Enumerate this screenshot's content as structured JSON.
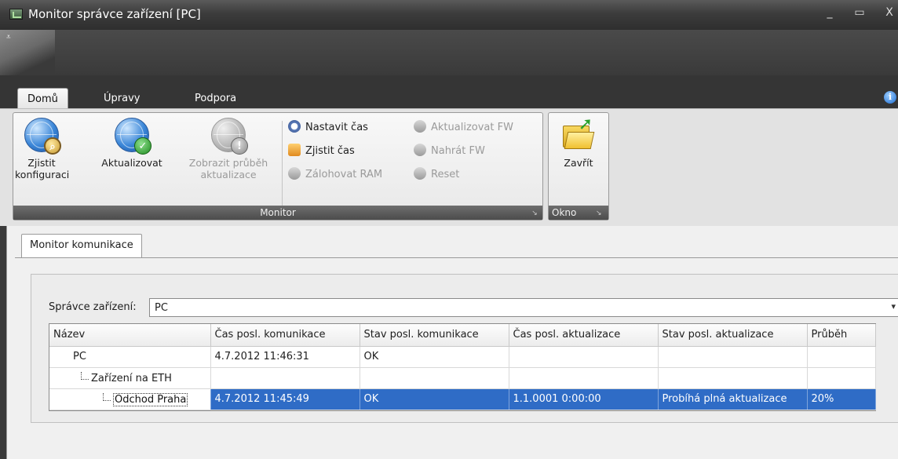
{
  "window": {
    "title": "Monitor správce zařízení [PC]",
    "controls": {
      "minimize": "_",
      "maximize": "▭",
      "close": "X"
    }
  },
  "quick_access": {
    "arrow": "⩡"
  },
  "ribbon": {
    "tabs": [
      {
        "label": "Domů"
      },
      {
        "label": "Úpravy"
      },
      {
        "label": "Podpora"
      }
    ],
    "info_icon": "i",
    "groups": {
      "monitor": {
        "label": "Monitor",
        "big_buttons": {
          "zjistit": "Zjistit\nkonfiguraci",
          "aktualizovat": "Aktualizovat",
          "zobrazit": "Zobrazit průběh\naktualizace"
        },
        "small_buttons": {
          "nastavit_cas": "Nastavit čas",
          "zjistit_cas": "Zjistit čas",
          "zalohovat_ram": "Zálohovat RAM",
          "aktualizovat_fw": "Aktualizovat FW",
          "nahrat_fw": "Nahrát FW",
          "reset": "Reset"
        }
      },
      "okno": {
        "label": "Okno",
        "close_button": "Zavřít"
      }
    }
  },
  "document": {
    "tab": "Monitor komunikace",
    "device_manager": {
      "label": "Správce zařízení:",
      "value": "PC"
    },
    "grid": {
      "columns": [
        "Název",
        "Čas posl. komunikace",
        "Stav posl. komunikace",
        "Čas posl. aktualizace",
        "Stav posl. aktualizace",
        "Průběh"
      ],
      "rows": [
        {
          "name": "PC",
          "cas_kom": "4.7.2012 11:46:31",
          "stav_kom": "OK",
          "cas_akt": "",
          "stav_akt": "",
          "prubeh": ""
        },
        {
          "name": "Zařízení na ETH",
          "cas_kom": "",
          "stav_kom": "",
          "cas_akt": "",
          "stav_akt": "",
          "prubeh": ""
        },
        {
          "name": "Odchod Praha",
          "cas_kom": "4.7.2012 11:45:49",
          "stav_kom": "OK",
          "cas_akt": "1.1.0001 0:00:00",
          "stav_akt": "Probíhá plná aktualizace",
          "prubeh": "20%"
        }
      ]
    }
  }
}
